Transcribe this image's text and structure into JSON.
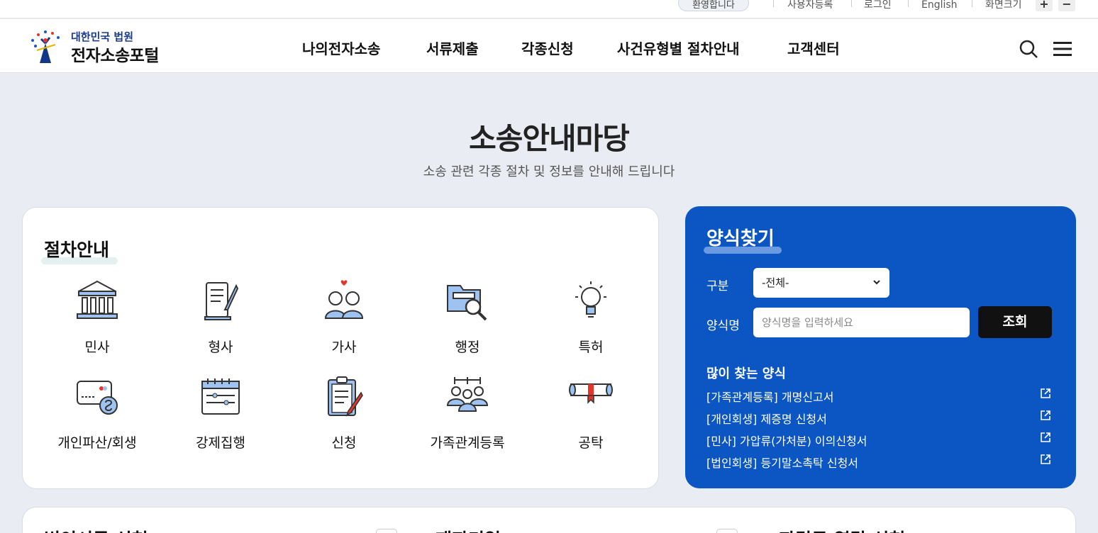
{
  "util": {
    "welcome": "환영합니다",
    "links": [
      "사용자등록",
      "로그인",
      "English"
    ],
    "zoom_label": "화면크기",
    "zoom_in": "+",
    "zoom_out": "−"
  },
  "logo": {
    "sub": "대한민국 법원",
    "main": "전자소송포털"
  },
  "nav": [
    "나의전자소송",
    "서류제출",
    "각종신청",
    "사건유형별 절차안내",
    "고객센터"
  ],
  "hero": {
    "title": "소송안내마당",
    "subtitle": "소송 관련 각종 절차 및 정보를 안내해 드립니다"
  },
  "procedure": {
    "title": "절차안내",
    "items": [
      "민사",
      "형사",
      "가사",
      "행정",
      "특허",
      "개인파산/회생",
      "강제집행",
      "신청",
      "가족관계등록",
      "공탁"
    ]
  },
  "form_search": {
    "title": "양식찾기",
    "category_label": "구분",
    "category_value": "-전체-",
    "name_label": "양식명",
    "name_placeholder": "양식명을 입력하세요",
    "search_button": "조회",
    "popular_title": "많이 찾는 양식",
    "popular": [
      "[가족관계등록] 개명신고서",
      "[개인회생] 제증명 신청서",
      "[민사] 가압류(가처분) 이의신청서",
      "[법인회생] 등기말소촉탁 신청서"
    ]
  },
  "bottom": {
    "sections": [
      "법인서류 신청",
      "재판기일",
      "판결문 열람 신청"
    ]
  },
  "colors": {
    "primary_blue": "#0b56c2",
    "background": "#e9edf3",
    "dark_button": "#111111"
  }
}
